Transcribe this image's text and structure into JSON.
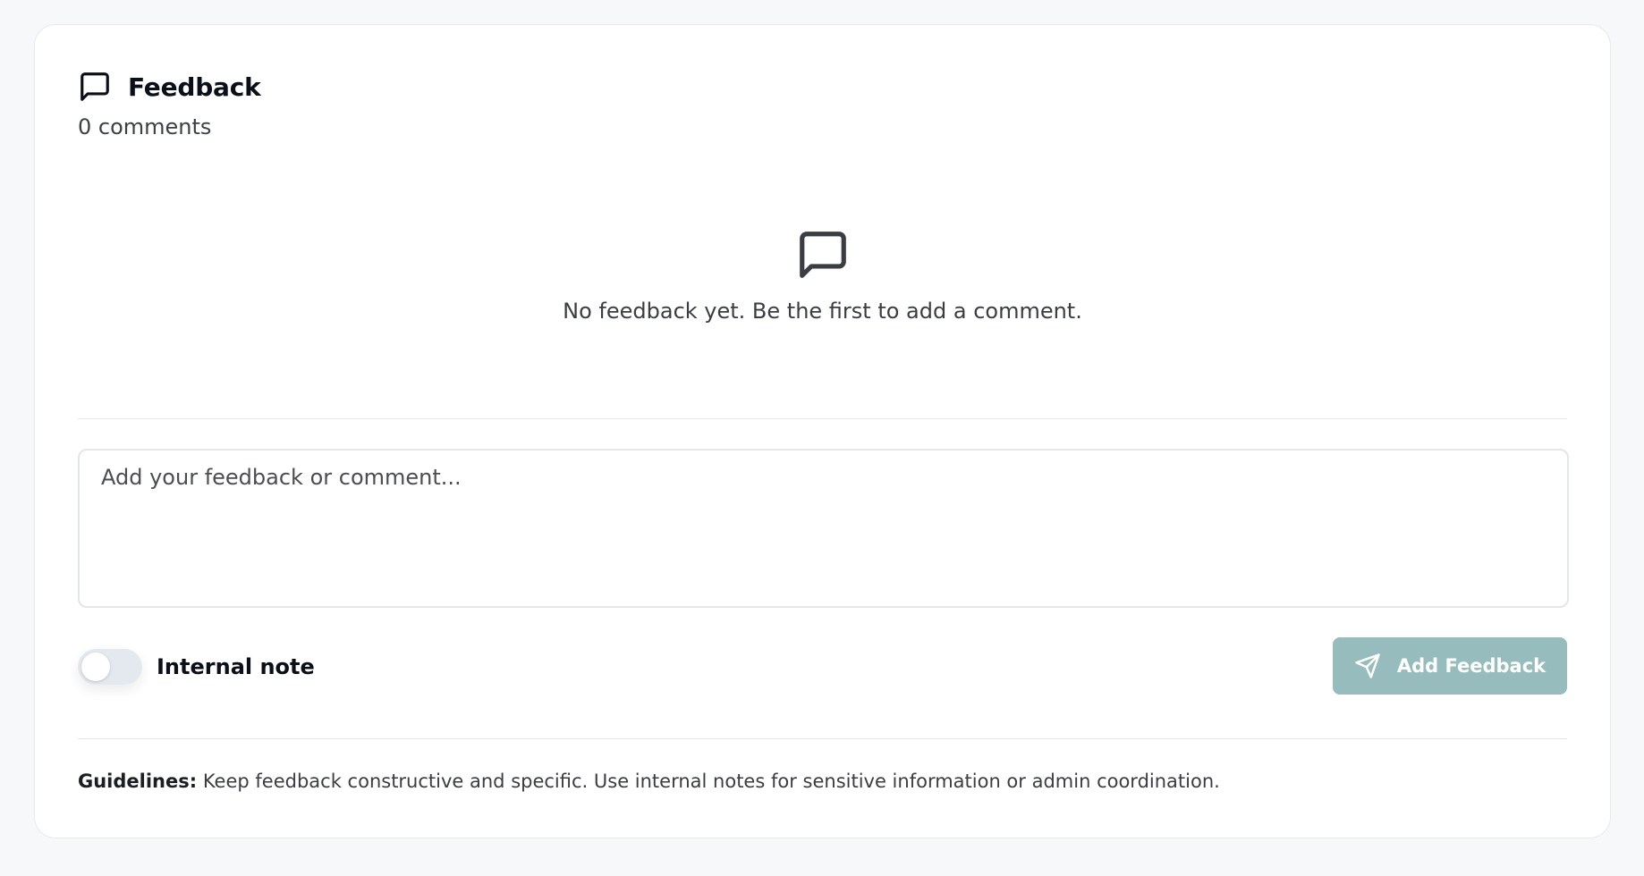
{
  "header": {
    "title": "Feedback",
    "count_text": "0 comments"
  },
  "empty_state": {
    "message": "No feedback yet. Be the first to add a comment."
  },
  "composer": {
    "placeholder": "Add your feedback or comment...",
    "value": "",
    "toggle_label": "Internal note",
    "toggle_on": false,
    "submit_label": "Add Feedback"
  },
  "guidelines": {
    "label": "Guidelines:",
    "text": " Keep feedback constructive and specific. Use internal notes for sensitive information or admin coordination."
  },
  "icons": {
    "header": "message-square-icon",
    "empty": "message-square-icon",
    "submit": "send-icon"
  },
  "colors": {
    "button_bg": "#97bcbd",
    "toggle_track": "#e4e9f0"
  }
}
